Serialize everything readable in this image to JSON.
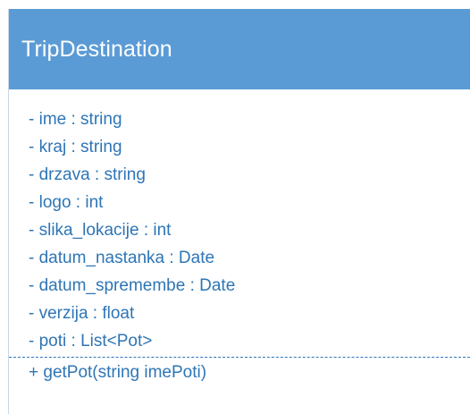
{
  "class": {
    "name": "TripDestination",
    "attributes": [
      "- ime : string",
      "- kraj : string",
      "- drzava : string",
      "- logo : int",
      "- slika_lokacije : int",
      "- datum_nastanka : Date",
      "- datum_spremembe : Date",
      "- verzija : float",
      "- poti : List<Pot>"
    ],
    "methods": [
      "+ getPot(string imePoti)"
    ]
  },
  "colors": {
    "header_bg": "#5b9bd5",
    "header_text": "#ffffff",
    "member_text": "#2e75b6"
  }
}
